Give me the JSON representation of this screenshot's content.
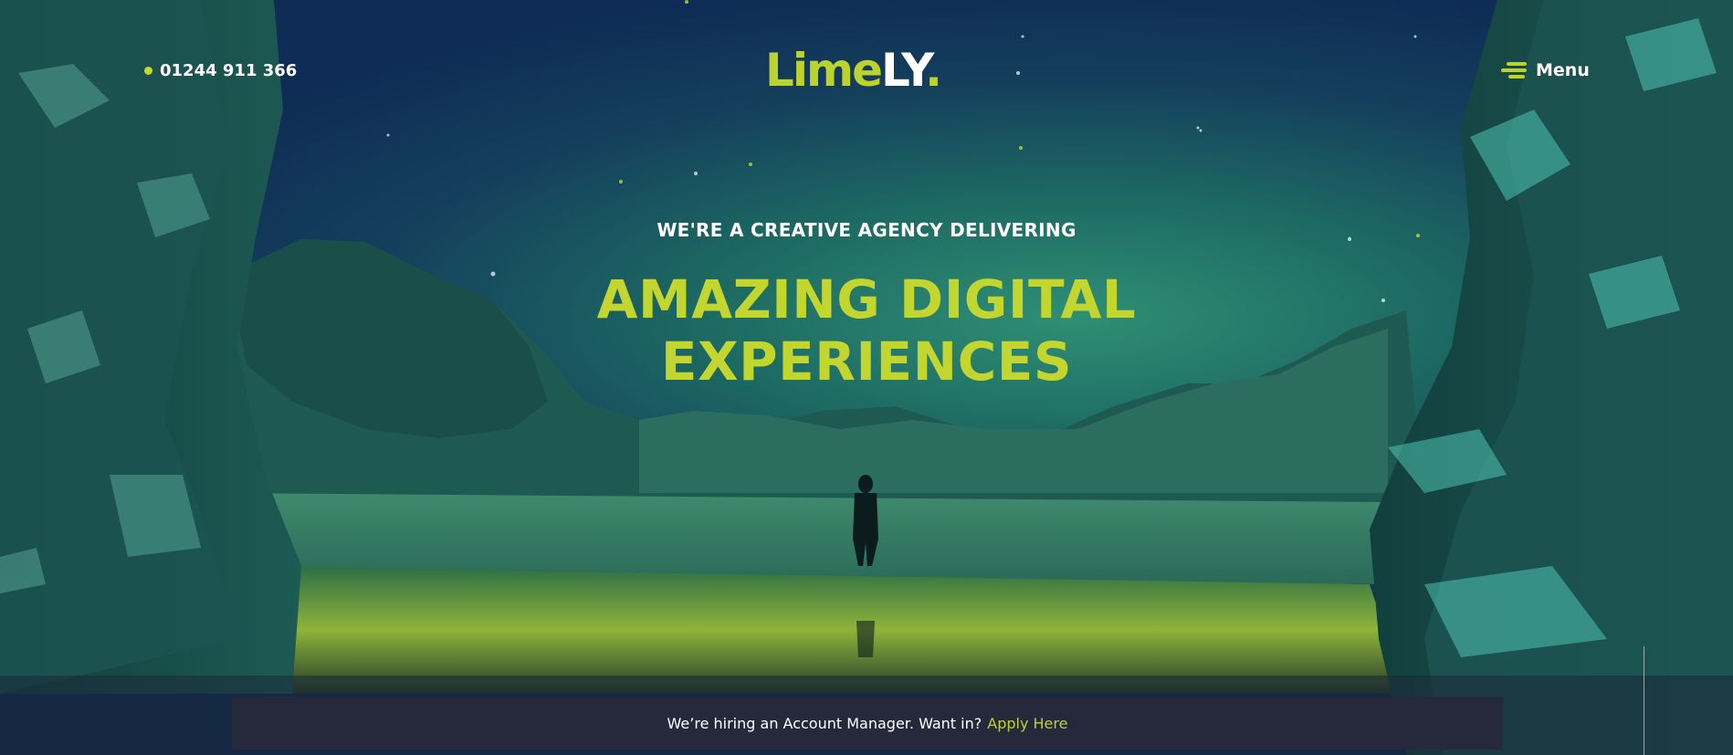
{
  "header": {
    "phone": "01244 911 366",
    "logo": {
      "part1": "Lime",
      "part2": "LY",
      "dot": "."
    },
    "menu_label": "Menu"
  },
  "hero": {
    "eyebrow": "WE'RE A CREATIVE AGENCY DELIVERING",
    "headline_line1": "AMAZING DIGITAL",
    "headline_line2": "EXPERIENCES"
  },
  "hiring_bar": {
    "text": "We’re hiring an Account Manager. Want in?",
    "link": "Apply Here"
  },
  "colors": {
    "accent": "#bcd22e",
    "text": "#ffffff",
    "bar_bg": "#26283c",
    "sky_dark": "#0e2c55",
    "aurora": "#2f8f74"
  },
  "icons": {
    "phone": "status-dot-icon",
    "menu": "hamburger-menu-icon"
  }
}
